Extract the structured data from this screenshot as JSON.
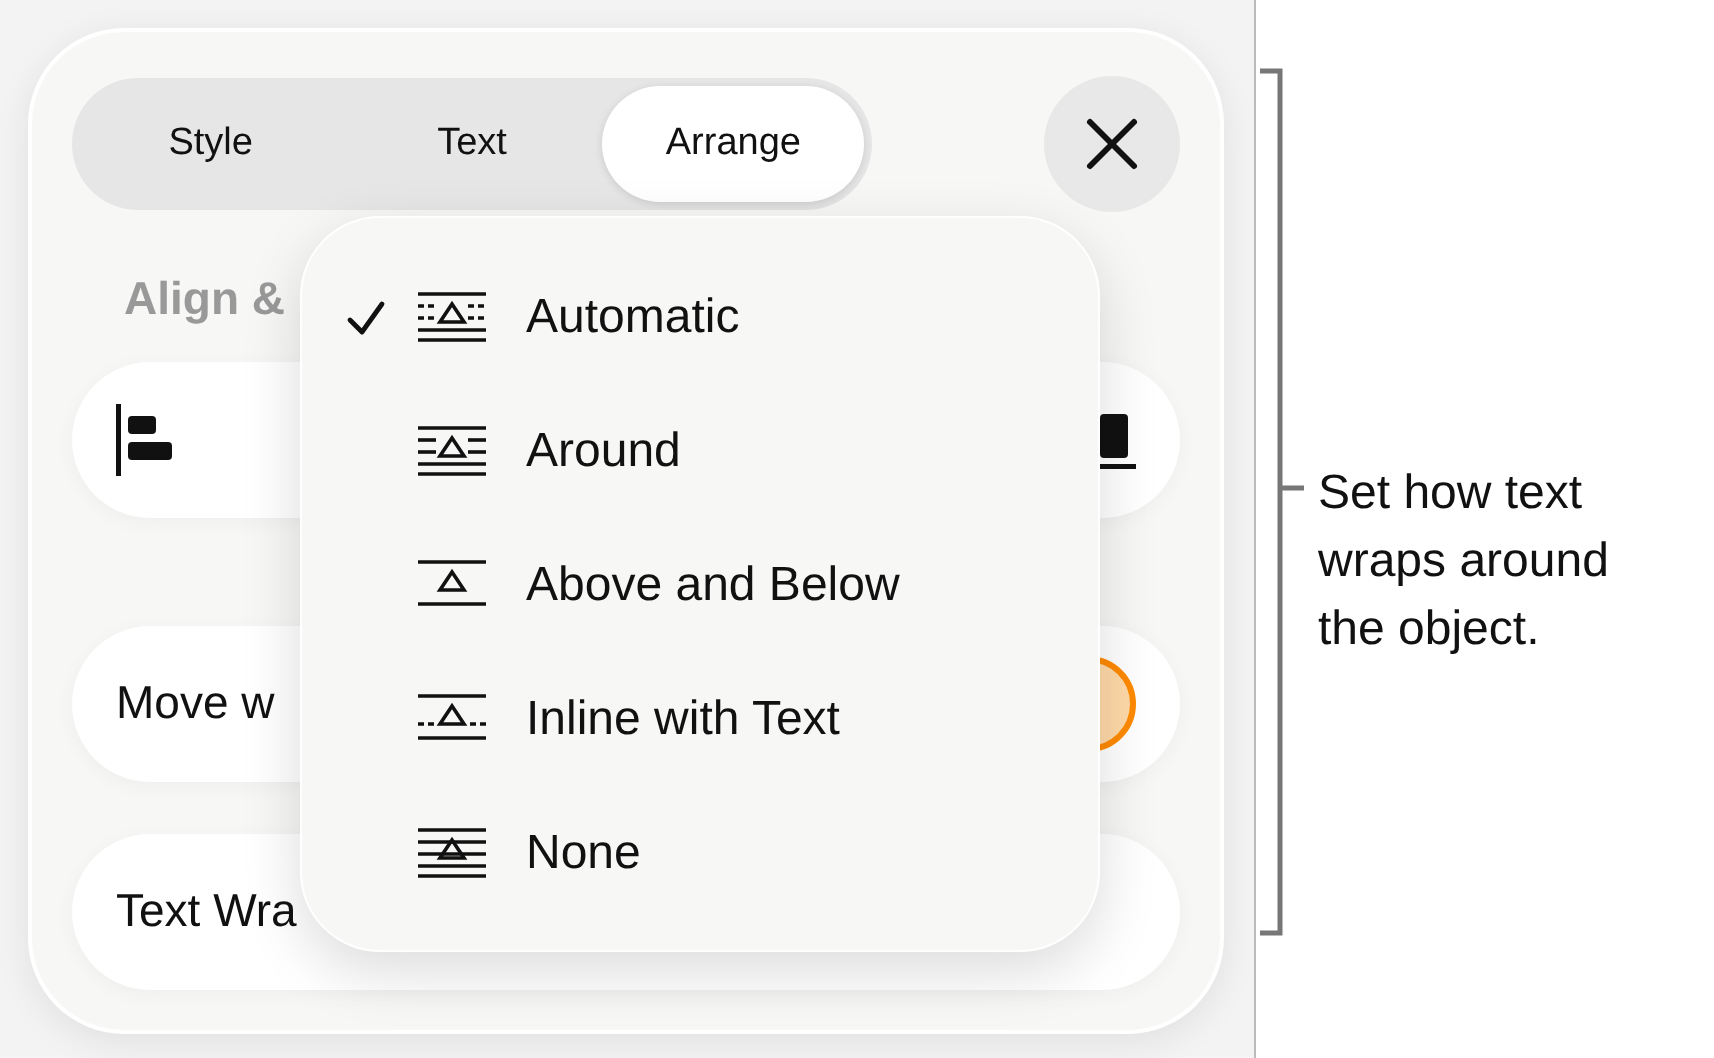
{
  "panel": {
    "tabs": [
      {
        "label": "Style",
        "selected": false
      },
      {
        "label": "Text",
        "selected": false
      },
      {
        "label": "Arrange",
        "selected": true
      }
    ],
    "section_label": "Align &",
    "move_row": {
      "label": "Move w",
      "toggle": {
        "on": true
      }
    },
    "wrap_row": {
      "label": "Text Wra"
    }
  },
  "wrap_menu": {
    "items": [
      {
        "kind": "automatic",
        "label": "Automatic",
        "checked": true
      },
      {
        "kind": "around",
        "label": "Around",
        "checked": false
      },
      {
        "kind": "above_below",
        "label": "Above and Below",
        "checked": false
      },
      {
        "kind": "inline",
        "label": "Inline with Text",
        "checked": false
      },
      {
        "kind": "none",
        "label": "None",
        "checked": false
      }
    ]
  },
  "callout": {
    "text": "Set how text wraps around the object."
  }
}
